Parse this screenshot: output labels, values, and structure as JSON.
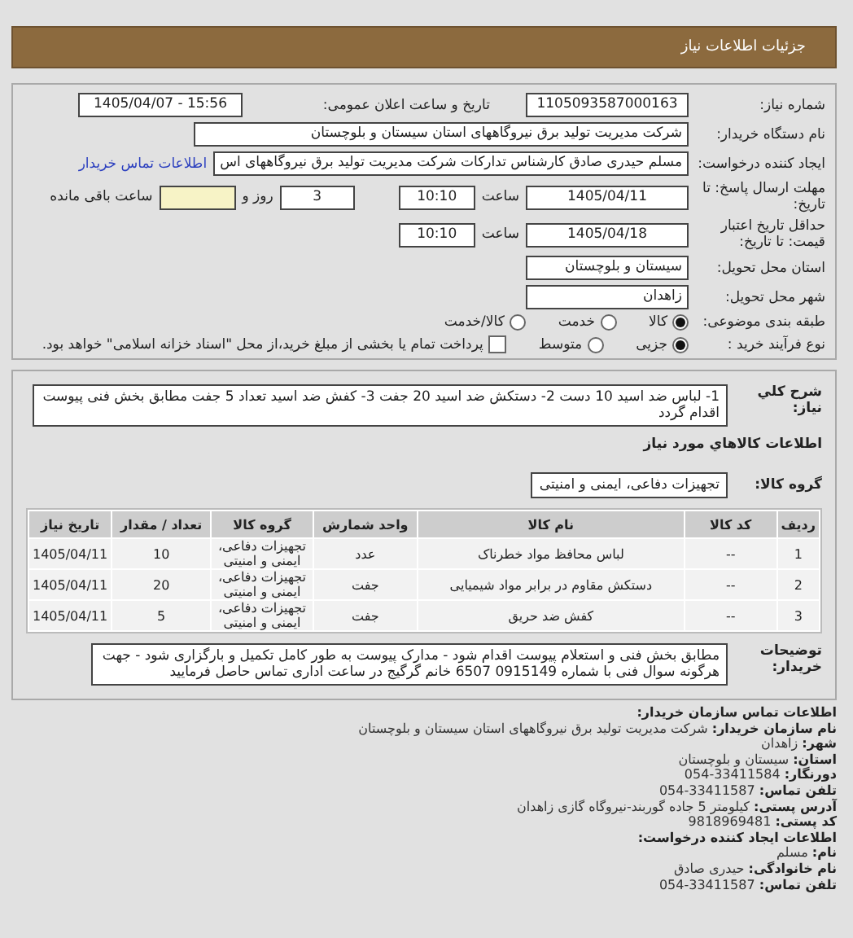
{
  "header": {
    "title": "جزئیات اطلاعات نیاز"
  },
  "form": {
    "rows": [
      {
        "label": "شماره نیاز:",
        "items": [
          {
            "kind": "field",
            "value": "1105093587000163"
          },
          {
            "kind": "text",
            "text": "تاریخ و ساعت اعلان عمومی:"
          },
          {
            "kind": "field",
            "value": "1405/04/07 - 15:56"
          }
        ]
      },
      {
        "label": "نام دستگاه خریدار:",
        "items": [
          {
            "kind": "field",
            "value": "شرکت مدیریت تولید برق نیروگاههای استان سیستان و بلوچستان"
          }
        ]
      },
      {
        "label": "ایجاد کننده درخواست:",
        "items": [
          {
            "kind": "field",
            "value": "مسلم حیدری صادق کارشناس تدارکات شرکت مدیریت تولید برق نیروگاههای اس"
          },
          {
            "kind": "link",
            "text": "اطلاعات تماس خریدار"
          }
        ]
      },
      {
        "label": "مهلت ارسال پاسخ: تا تاریخ:",
        "items": [
          {
            "kind": "field",
            "value": "1405/04/11"
          },
          {
            "kind": "text",
            "text": "ساعت"
          },
          {
            "kind": "field",
            "value": "10:10"
          },
          {
            "kind": "field",
            "value": "3"
          },
          {
            "kind": "text",
            "text": "روز و"
          },
          {
            "kind": "blank"
          },
          {
            "kind": "text",
            "text": "ساعت باقی مانده"
          }
        ]
      },
      {
        "label": "حداقل تاریخ اعتبار قیمت: تا تاریخ:",
        "items": [
          {
            "kind": "field",
            "value": "1405/04/18"
          },
          {
            "kind": "text",
            "text": "ساعت"
          },
          {
            "kind": "field",
            "value": "10:10"
          }
        ]
      },
      {
        "label": "استان محل تحویل:",
        "items": [
          {
            "kind": "field",
            "value": "سیستان و بلوچستان"
          }
        ]
      },
      {
        "label": "شهر محل تحویل:",
        "items": [
          {
            "kind": "field",
            "value": "زاهدان"
          }
        ]
      },
      {
        "label": "طبقه بندی موضوعی:",
        "items": [
          {
            "kind": "radio",
            "text": "کالا",
            "selected": true
          },
          {
            "kind": "radio",
            "text": "خدمت",
            "selected": false
          },
          {
            "kind": "radio",
            "text": "کالا/خدمت",
            "selected": false
          }
        ]
      },
      {
        "label": "نوع فرآیند خرید :",
        "items": [
          {
            "kind": "radio",
            "text": "جزیی",
            "selected": true
          },
          {
            "kind": "radio",
            "text": "متوسط",
            "selected": false
          },
          {
            "kind": "checkbox",
            "text": "پرداخت تمام یا بخشی از مبلغ خرید،از محل \"اسناد خزانه اسلامی\" خواهد بود.",
            "checked": false
          }
        ]
      }
    ]
  },
  "needs": {
    "description_label": "شرح کلي نياز:",
    "description": "1- لباس ضد اسید 10 دست 2- دستکش ضد اسید 20 جفت 3- کفش ضد اسید تعداد 5 جفت مطابق بخش فنی پیوست اقدام گردد",
    "goods_heading": "اطلاعات کالاهاي مورد نياز",
    "group_label": "گروه کالا:",
    "group": "تجهیزات دفاعی، ایمنی و امنیتی",
    "table": {
      "columns": [
        "ردیف",
        "کد کالا",
        "نام کالا",
        "واحد شمارش",
        "گروه کالا",
        "تعداد / مقدار",
        "تاریخ نیاز"
      ],
      "rows": [
        [
          "1",
          "--",
          "لباس محافظ مواد خطرناک",
          "عدد",
          "تجهیزات دفاعی، ایمنی و امنیتی",
          "10",
          "1405/04/11"
        ],
        [
          "2",
          "--",
          "دستکش مقاوم در برابر مواد شیمیایی",
          "جفت",
          "تجهیزات دفاعی، ایمنی و امنیتی",
          "20",
          "1405/04/11"
        ],
        [
          "3",
          "--",
          "کفش ضد حریق",
          "جفت",
          "تجهیزات دفاعی، ایمنی و امنیتی",
          "5",
          "1405/04/11"
        ]
      ]
    },
    "notes_label": "توضیحات خریدار:",
    "notes": "مطابق بخش فنی و استعلام پیوست اقدام شود - مدارک پیوست به طور کامل تکمیل و بارگزاری شود - جهت هرگونه سوال فنی با شماره 0915149 6507 خانم گرگیج در ساعت اداری تماس حاصل فرمایید"
  },
  "contact": {
    "lines": [
      {
        "label": "اطلاعات تماس سازمان خریدار:"
      },
      {
        "label": "نام سازمان خریدار:",
        "value": "شرکت مدیریت تولید برق نیروگاههای استان سیستان و بلوچستان"
      },
      {
        "label": "شهر:",
        "value": "زاهدان"
      },
      {
        "label": "استان:",
        "value": "سیستان و بلوچستان"
      },
      {
        "label": "دورنگار:",
        "value": "33411584-054"
      },
      {
        "label": "تلفن تماس:",
        "value": "33411587-054"
      },
      {
        "label": "آدرس پستی:",
        "value": "کیلومتر 5 جاده گوربند-نیروگاه گازی زاهدان"
      },
      {
        "label": "کد پستی:",
        "value": "9818969481"
      },
      {
        "label": "اطلاعات ایجاد کننده درخواست:"
      },
      {
        "label": "نام:",
        "value": "مسلم"
      },
      {
        "label": "نام خانوادگی:",
        "value": "حیدری صادق"
      },
      {
        "label": "تلفن تماس:",
        "value": "33411587-054"
      }
    ]
  }
}
